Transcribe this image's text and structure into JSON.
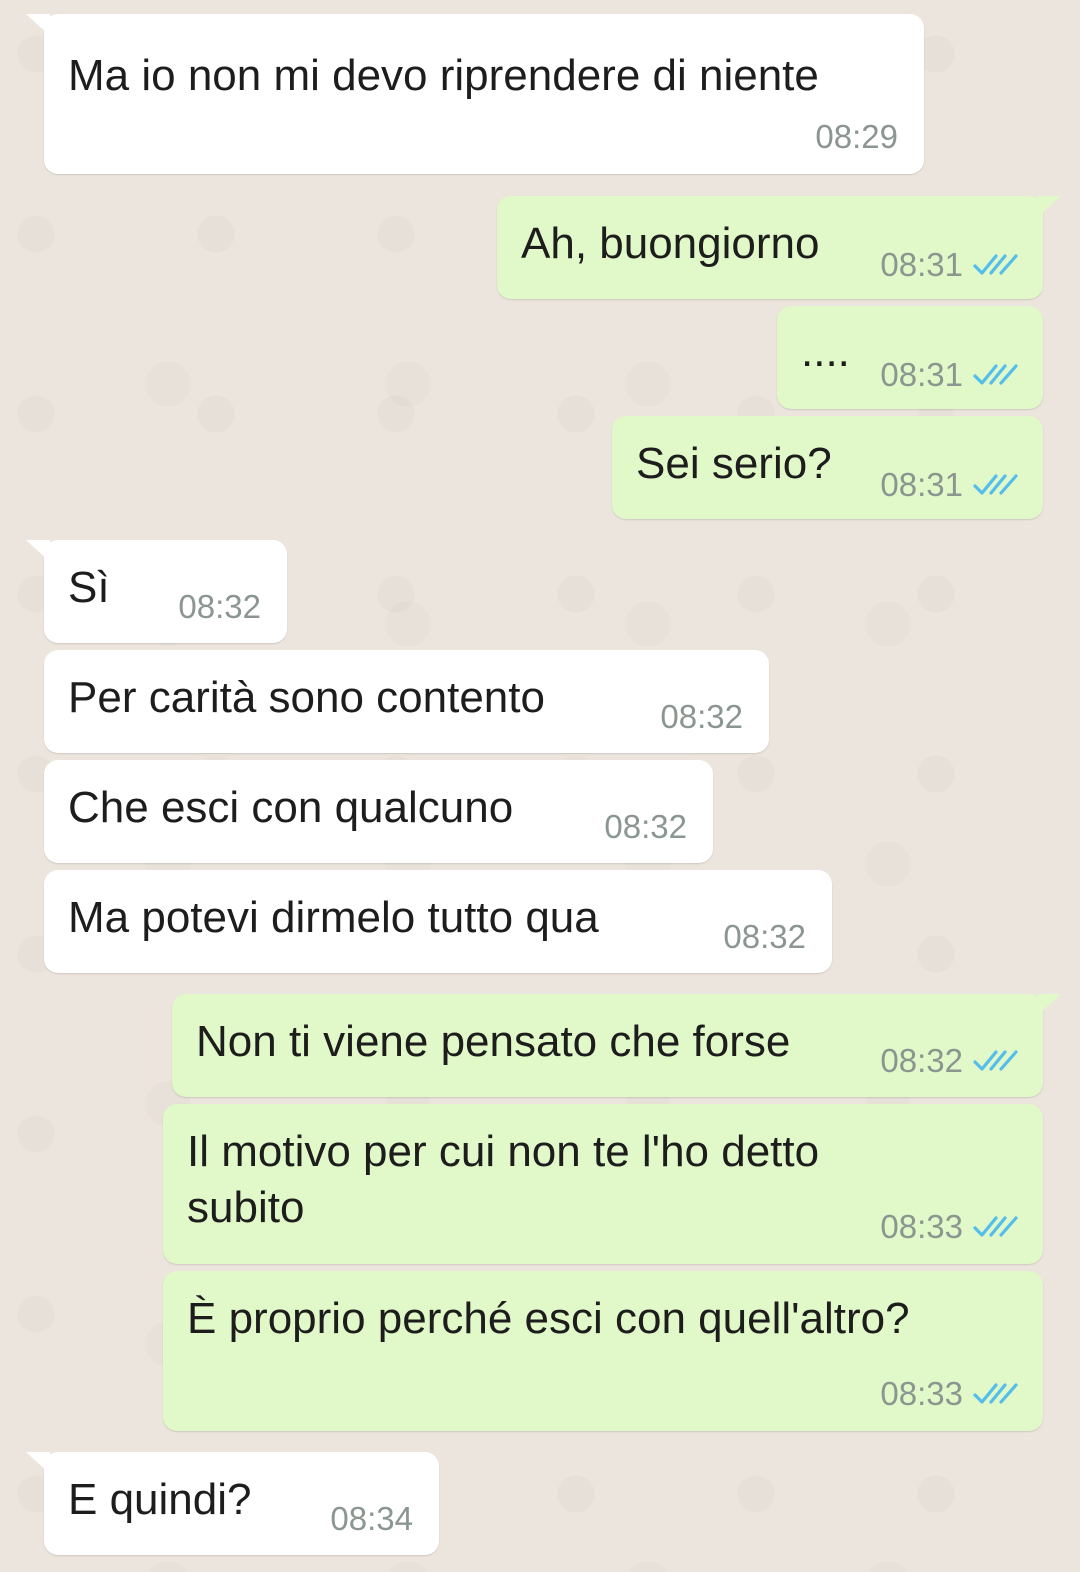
{
  "messages": [
    {
      "dir": "in",
      "text": "Ma io non mi devo riprendere di niente",
      "time": "08:29"
    },
    {
      "dir": "out",
      "text": "Ah, buongiorno",
      "time": "08:31",
      "status": "read-double-check-icon"
    },
    {
      "dir": "out",
      "text": "....",
      "time": "08:31",
      "status": "read-double-check-icon"
    },
    {
      "dir": "out",
      "text": "Sei serio?",
      "time": "08:31",
      "status": "read-double-check-icon"
    },
    {
      "dir": "in",
      "text": "Sì",
      "time": "08:32"
    },
    {
      "dir": "in",
      "text": "Per carità sono contento",
      "time": "08:32"
    },
    {
      "dir": "in",
      "text": "Che esci con qualcuno",
      "time": "08:32"
    },
    {
      "dir": "in",
      "text": "Ma potevi dirmelo tutto qua",
      "time": "08:32"
    },
    {
      "dir": "out",
      "text": "Non ti viene pensato che forse",
      "time": "08:32",
      "status": "read-double-check-icon"
    },
    {
      "dir": "out",
      "text": "Il motivo per cui non te l'ho detto subito",
      "time": "08:33",
      "status": "read-double-check-icon"
    },
    {
      "dir": "out",
      "text": "È proprio perché esci con quell'altro?",
      "time": "08:33",
      "status": "read-double-check-icon"
    },
    {
      "dir": "in",
      "text": "E quindi?",
      "time": "08:34"
    }
  ],
  "colors": {
    "background": "#ece5dd",
    "incoming_bubble": "#ffffff",
    "outgoing_bubble": "#e1f8c8",
    "read_ticks": "#53bdeb",
    "timestamp": "#8c9690"
  }
}
